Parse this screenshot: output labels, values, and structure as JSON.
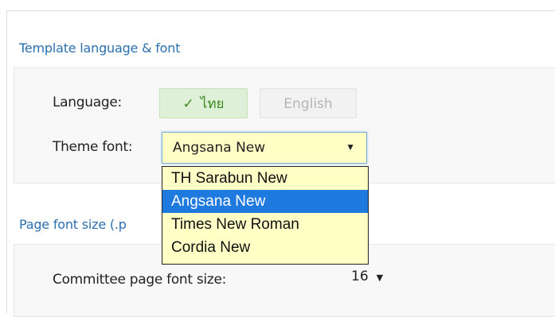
{
  "template_section": {
    "heading": "Template language & font",
    "language_label": "Language:",
    "language_options": [
      {
        "label": "ไทย",
        "active": true
      },
      {
        "label": "English",
        "active": false
      }
    ],
    "check_icon": "✓",
    "theme_font_label": "Theme font:",
    "theme_font_value": "Angsana New",
    "theme_font_options": [
      "TH Sarabun New",
      "Angsana New",
      "Times New Roman",
      "Cordia New"
    ],
    "selected_option": "Angsana New"
  },
  "font_size_section": {
    "heading": "Page font size (.p",
    "committee_label": "Committee page font size:",
    "committee_value": "16"
  },
  "icons": {
    "dropdown_arrow": "▼"
  },
  "colors": {
    "heading": "#2a6fb0",
    "select_bg": "#ffffc6",
    "option_highlight": "#1f7ae0",
    "active_lang_bg": "#dff0d8",
    "active_lang_text": "#3c8a1f"
  }
}
